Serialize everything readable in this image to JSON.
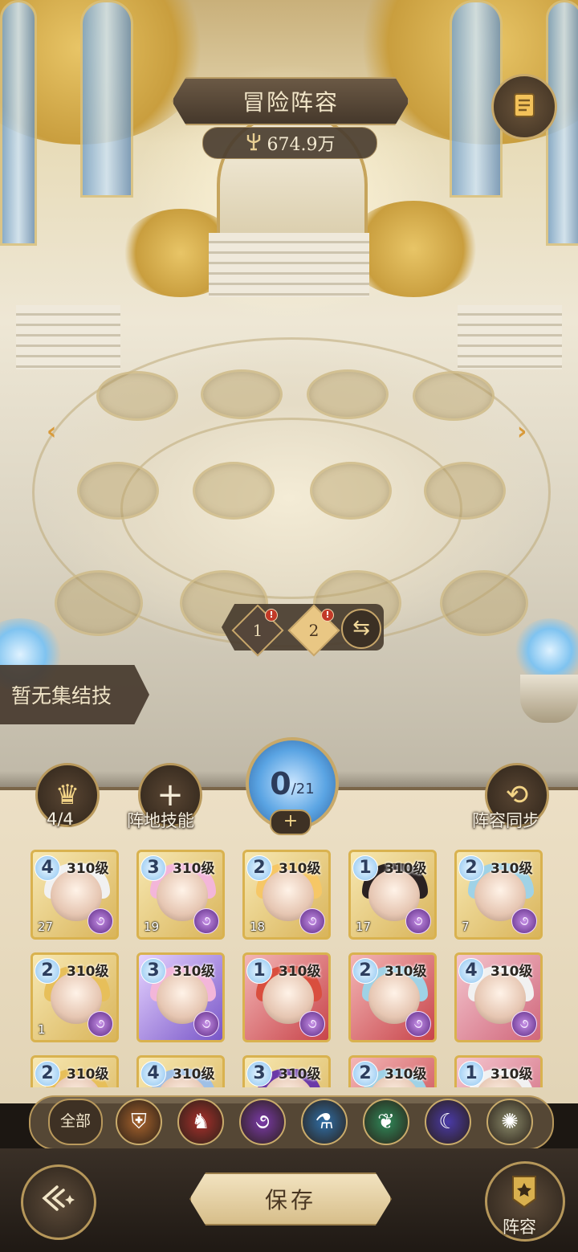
{
  "header": {
    "title": "冒险阵容",
    "power": "674.9万",
    "power_icon": "trident-icon",
    "menu_icon": "scroll-menu-icon"
  },
  "formation": {
    "team_tabs": [
      {
        "label": "1",
        "alert": "!"
      },
      {
        "label": "2",
        "alert": "!"
      }
    ],
    "swap_icon": "swap-arrows-icon",
    "combo_skill": "暂无集结技"
  },
  "panel": {
    "faction_count": "4/4",
    "field_skill": "阵地技能",
    "field_skill_icon": "plus-icon",
    "deployed": "0",
    "deployed_max": "/21",
    "sync": "阵容同步"
  },
  "heroes": [
    {
      "stars": "4",
      "level": "310级",
      "copies": "27",
      "theme": "gold"
    },
    {
      "stars": "3",
      "level": "310级",
      "copies": "19",
      "theme": "gold"
    },
    {
      "stars": "2",
      "level": "310级",
      "copies": "18",
      "theme": "gold"
    },
    {
      "stars": "1",
      "level": "310级",
      "copies": "17",
      "theme": "gold"
    },
    {
      "stars": "2",
      "level": "310级",
      "copies": "7",
      "theme": "gold"
    },
    {
      "stars": "2",
      "level": "310级",
      "copies": "1",
      "theme": "gold"
    },
    {
      "stars": "3",
      "level": "310级",
      "copies": "",
      "theme": "purple"
    },
    {
      "stars": "1",
      "level": "310级",
      "copies": "",
      "theme": "red"
    },
    {
      "stars": "2",
      "level": "310级",
      "copies": "",
      "theme": "red"
    },
    {
      "stars": "4",
      "level": "310级",
      "copies": "",
      "theme": "pink"
    },
    {
      "stars": "2",
      "level": "310级",
      "copies": "",
      "theme": "gold"
    },
    {
      "stars": "4",
      "level": "310级",
      "copies": "",
      "theme": "gold"
    },
    {
      "stars": "3",
      "level": "310级",
      "copies": "",
      "theme": "gold"
    },
    {
      "stars": "2",
      "level": "310级",
      "copies": "",
      "theme": "red"
    },
    {
      "stars": "1",
      "level": "310级",
      "copies": "",
      "theme": "pink"
    }
  ],
  "filters": {
    "all": "全部",
    "icons": [
      {
        "name": "shield-faction-icon",
        "color": "#a8632c"
      },
      {
        "name": "horse-faction-icon",
        "color": "#a8302c"
      },
      {
        "name": "swirl-faction-icon",
        "color": "#7a3aa8"
      },
      {
        "name": "potion-faction-icon",
        "color": "#2f6fa8"
      },
      {
        "name": "leaf-faction-icon",
        "color": "#2f8a5a"
      },
      {
        "name": "moon-faction-icon",
        "color": "#4a3aa8"
      },
      {
        "name": "sun-faction-icon",
        "color": "#8a8a6a"
      }
    ]
  },
  "footer": {
    "save": "保存",
    "lineup": "阵容"
  }
}
